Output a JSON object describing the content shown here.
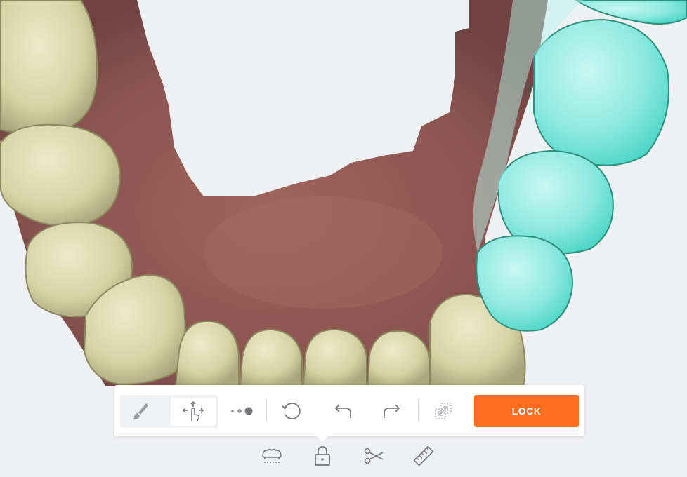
{
  "toolbar": {
    "lock_label": "LOCK",
    "tools": [
      {
        "icon": "brush-icon",
        "state": "inactive"
      },
      {
        "icon": "touch-move-icon",
        "state": "active"
      },
      {
        "icon": "brush-size-icon",
        "state": "inactive"
      },
      {
        "icon": "reset-rotate-icon",
        "state": "inactive"
      },
      {
        "icon": "undo-icon",
        "state": "inactive"
      },
      {
        "icon": "redo-icon",
        "state": "inactive"
      },
      {
        "icon": "expand-selection-icon",
        "state": "disabled"
      }
    ]
  },
  "bottom_tabs": [
    {
      "icon": "jaw-icon"
    },
    {
      "icon": "lock-icon",
      "selected": true
    },
    {
      "icon": "scissors-icon"
    },
    {
      "icon": "ruler-icon"
    }
  ],
  "colors": {
    "accent": "#ff6e1f",
    "selection_highlight": "#7ee8e0",
    "tooth": "#d6d3a4",
    "gum": "#8a5550",
    "background": "#eff0f2",
    "icon": "#77787c"
  }
}
